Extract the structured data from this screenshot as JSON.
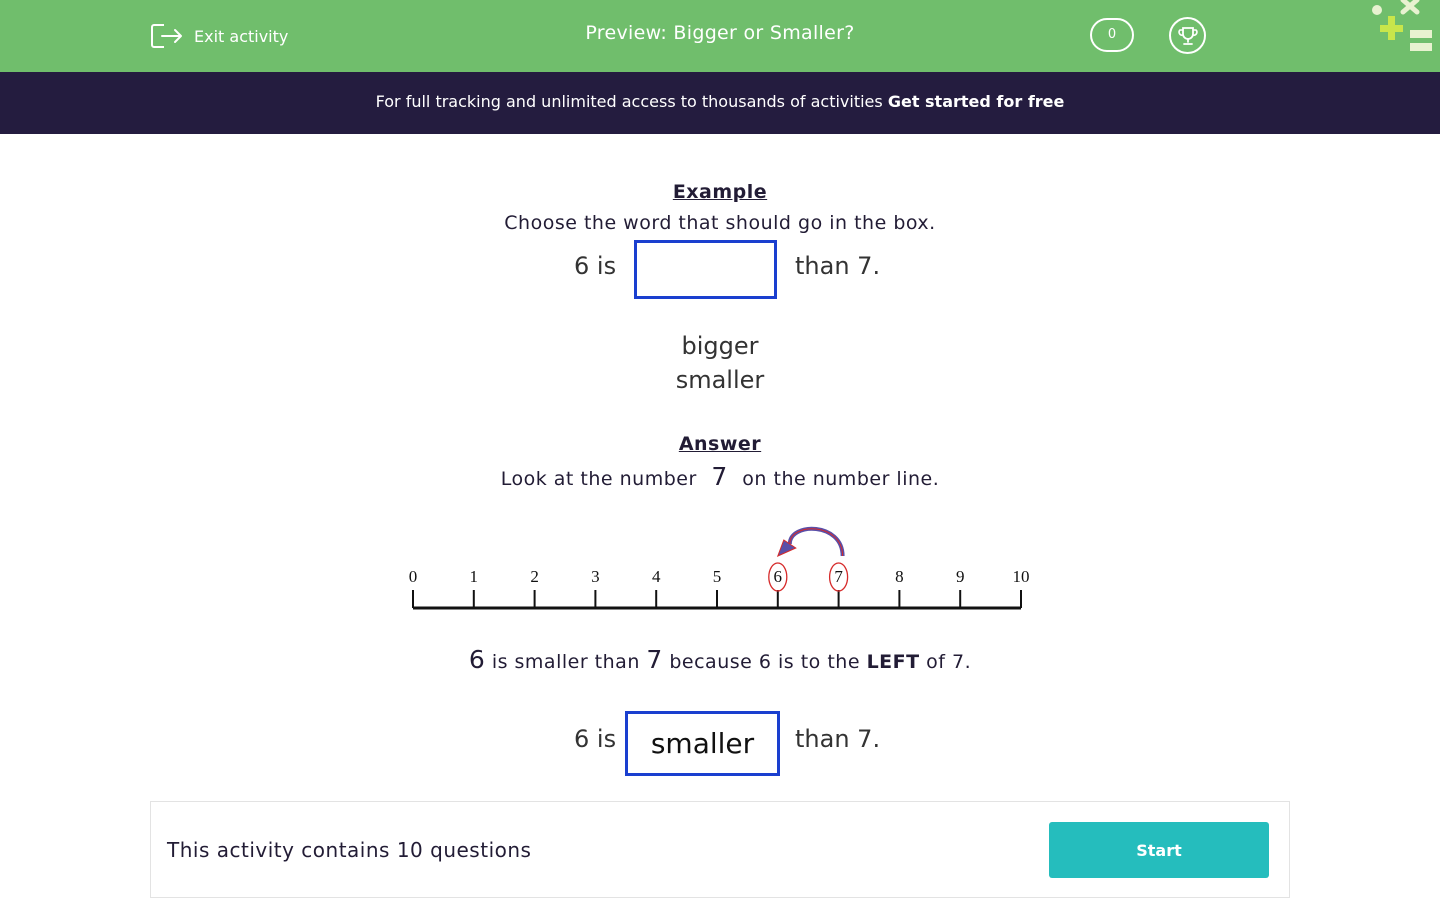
{
  "header": {
    "exit_label": "Exit activity",
    "title": "Preview: Bigger or Smaller?",
    "score": "0"
  },
  "promo": {
    "text": "For full tracking and unlimited access to thousands of activities",
    "link": "Get started for free"
  },
  "example": {
    "heading": "Example",
    "instruction": "Choose the word that should go in the box.",
    "sentence_pre": "6 is",
    "sentence_post": "than 7.",
    "options": [
      "bigger",
      "smaller"
    ]
  },
  "answer": {
    "heading": "Answer",
    "line1_pre": "Look at the number",
    "line1_num": "7",
    "line1_post": "on the number line.",
    "explain_num1": "6",
    "explain_mid": "is smaller than",
    "explain_num2": "7",
    "explain_rest1": "because 6 is to the",
    "explain_bold": "LEFT",
    "explain_rest2": "of 7.",
    "sentence_pre": "6 is",
    "sentence_answer": "smaller",
    "sentence_post": "than 7."
  },
  "number_line": {
    "ticks": [
      "0",
      "1",
      "2",
      "3",
      "4",
      "5",
      "6",
      "7",
      "8",
      "9",
      "10"
    ],
    "circled": [
      "6",
      "7"
    ],
    "arrow_from": "7",
    "arrow_to": "6",
    "circle_color": "#d62a2a",
    "arrow_color": "#5a4fa8"
  },
  "footer": {
    "info": "This activity contains 10 questions",
    "start_label": "Start"
  },
  "colors": {
    "topbar": "#70be6c",
    "promo": "#241c3f",
    "answer_box": "#1a3fcf",
    "start_button": "#25bdbd"
  }
}
